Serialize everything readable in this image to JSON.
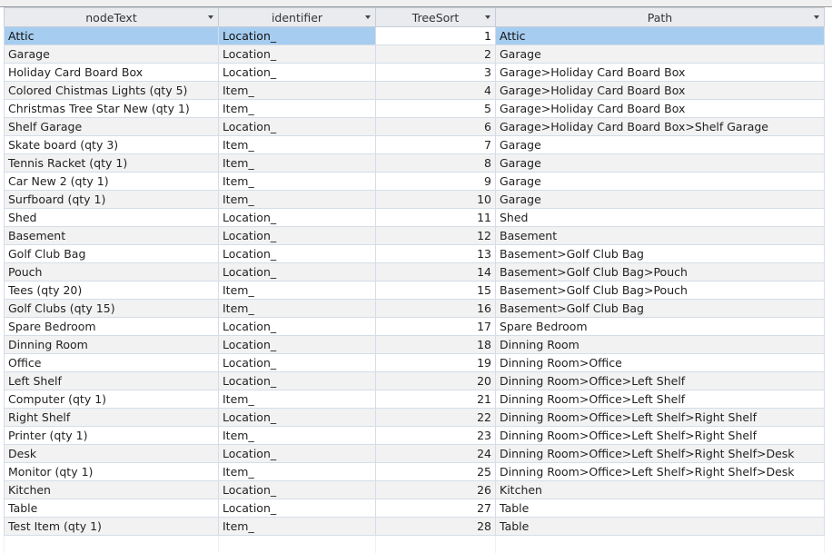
{
  "columns": [
    {
      "label": "nodeText"
    },
    {
      "label": "identifier"
    },
    {
      "label": "TreeSort"
    },
    {
      "label": "Path"
    }
  ],
  "rows": [
    [
      "Attic",
      "Location_",
      "1",
      "Attic"
    ],
    [
      "Garage",
      "Location_",
      "2",
      "Garage"
    ],
    [
      "Holiday Card Board Box",
      "Location_",
      "3",
      "Garage>Holiday Card Board Box"
    ],
    [
      "Colored Chistmas Lights (qty 5)",
      "Item_",
      "4",
      "Garage>Holiday Card Board Box"
    ],
    [
      "Christmas Tree Star New (qty 1)",
      "Item_",
      "5",
      "Garage>Holiday Card Board Box"
    ],
    [
      "Shelf Garage",
      "Location_",
      "6",
      "Garage>Holiday Card Board Box>Shelf Garage"
    ],
    [
      "Skate board (qty 3)",
      "Item_",
      "7",
      "Garage"
    ],
    [
      "Tennis Racket (qty 1)",
      "Item_",
      "8",
      "Garage"
    ],
    [
      "Car New 2 (qty 1)",
      "Item_",
      "9",
      "Garage"
    ],
    [
      "Surfboard (qty 1)",
      "Item_",
      "10",
      "Garage"
    ],
    [
      "Shed",
      "Location_",
      "11",
      "Shed"
    ],
    [
      "Basement",
      "Location_",
      "12",
      "Basement"
    ],
    [
      "Golf Club Bag",
      "Location_",
      "13",
      "Basement>Golf Club Bag"
    ],
    [
      "Pouch",
      "Location_",
      "14",
      "Basement>Golf Club Bag>Pouch"
    ],
    [
      "Tees (qty 20)",
      "Item_",
      "15",
      "Basement>Golf Club Bag>Pouch"
    ],
    [
      "Golf Clubs (qty 15)",
      "Item_",
      "16",
      "Basement>Golf Club Bag"
    ],
    [
      "Spare Bedroom",
      "Location_",
      "17",
      "Spare Bedroom"
    ],
    [
      "Dinning Room",
      "Location_",
      "18",
      "Dinning Room"
    ],
    [
      "Office",
      "Location_",
      "19",
      "Dinning Room>Office"
    ],
    [
      "Left Shelf",
      "Location_",
      "20",
      "Dinning Room>Office>Left Shelf"
    ],
    [
      "Computer (qty 1)",
      "Item_",
      "21",
      "Dinning Room>Office>Left Shelf"
    ],
    [
      "Right Shelf",
      "Location_",
      "22",
      "Dinning Room>Office>Left Shelf>Right Shelf"
    ],
    [
      "Printer (qty 1)",
      "Item_",
      "23",
      "Dinning Room>Office>Left Shelf>Right Shelf"
    ],
    [
      "Desk",
      "Location_",
      "24",
      "Dinning Room>Office>Left Shelf>Right Shelf>Desk"
    ],
    [
      "Monitor (qty 1)",
      "Item_",
      "25",
      "Dinning Room>Office>Left Shelf>Right Shelf>Desk"
    ],
    [
      "Kitchen",
      "Location_",
      "26",
      "Kitchen"
    ],
    [
      "Table",
      "Location_",
      "27",
      "Table"
    ],
    [
      "Test Item (qty 1)",
      "Item_",
      "28",
      "Table"
    ]
  ]
}
